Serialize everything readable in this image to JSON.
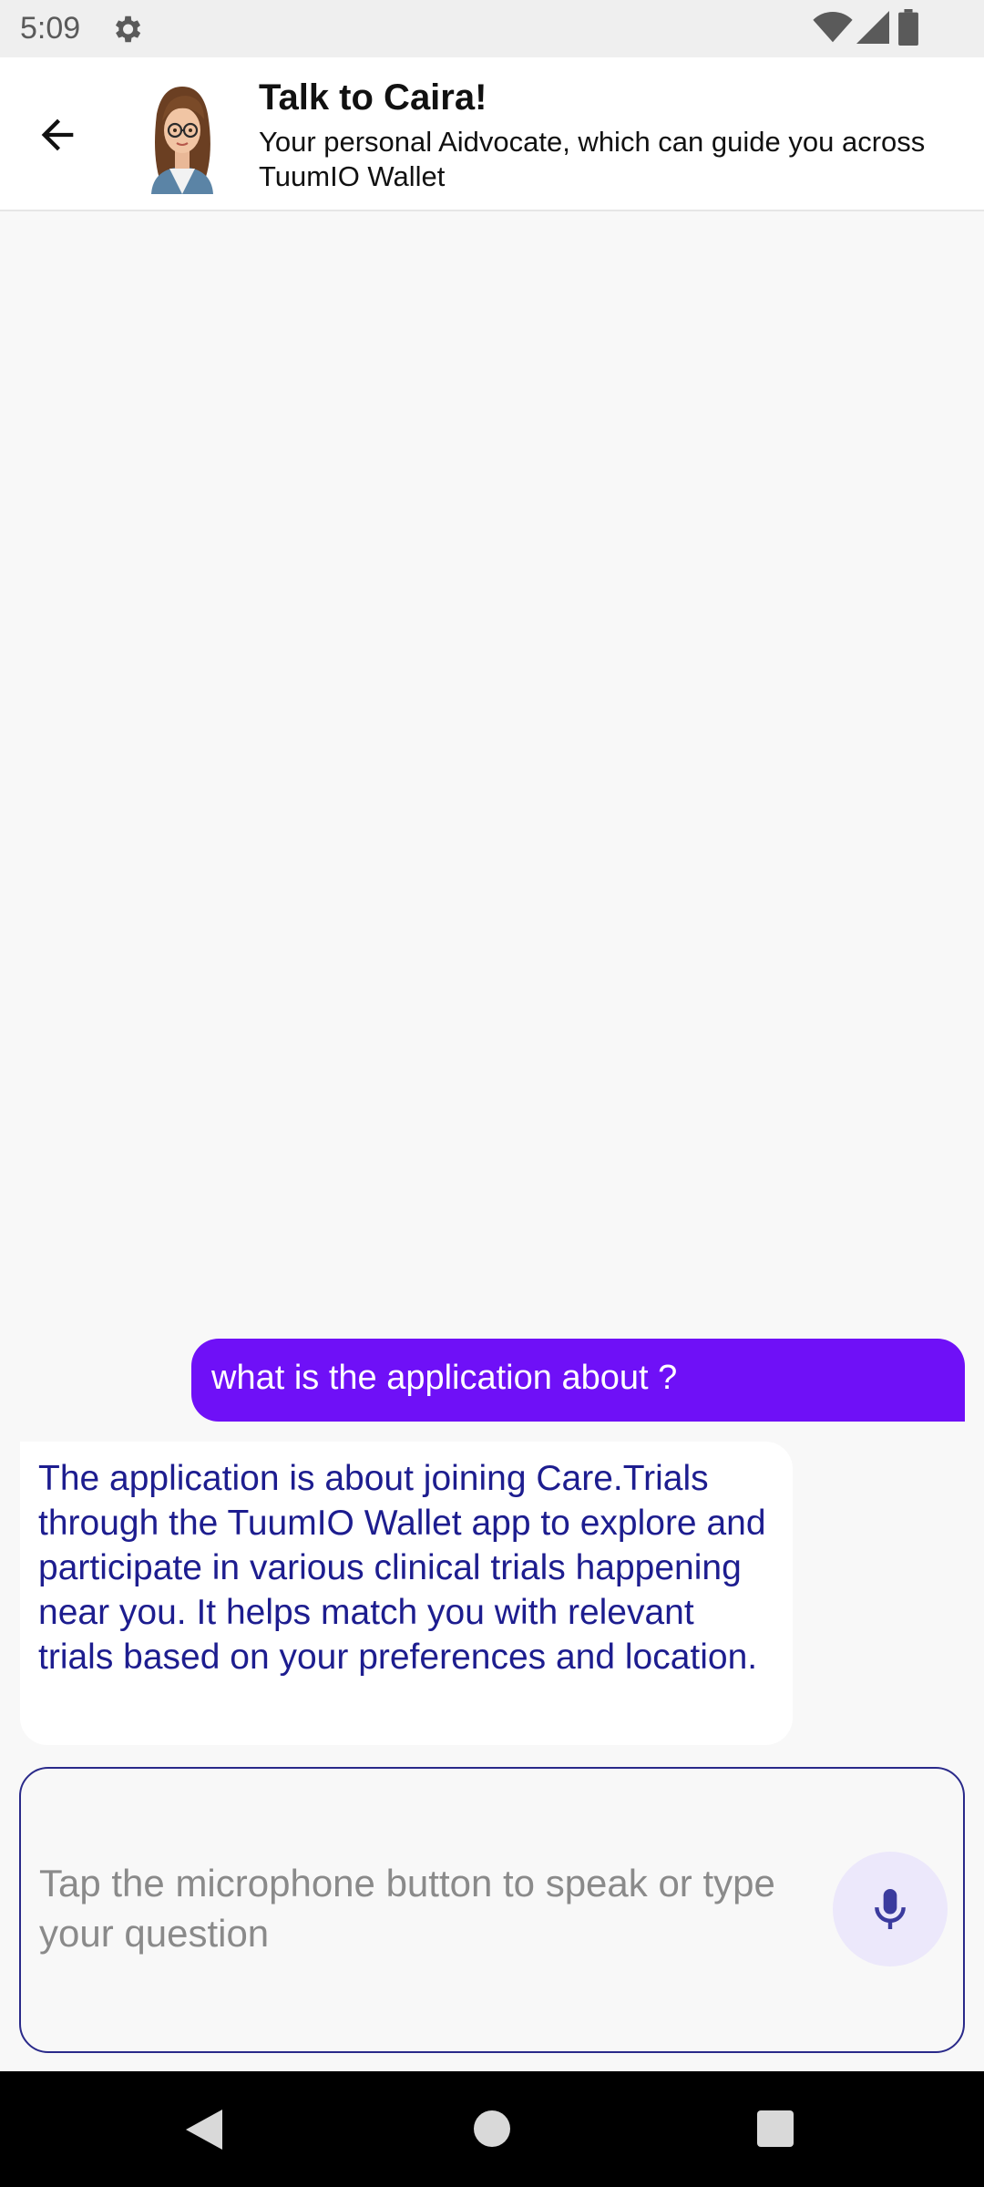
{
  "status_bar": {
    "time": "5:09",
    "icons": [
      "settings-icon",
      "wifi-icon",
      "signal-icon",
      "battery-icon"
    ]
  },
  "header": {
    "back_icon": "arrow-left-icon",
    "title": "Talk to Caira!",
    "subtitle": "Your personal Aidvocate, which can guide you across TuumIO Wallet"
  },
  "messages": [
    {
      "sender": "user",
      "text": "what is the application about ?"
    },
    {
      "sender": "assistant",
      "text": "The application is about joining Care.Trials through the TuumIO Wallet app to explore and participate in various clinical trials happening near you. It helps match you with relevant trials based on your preferences and location."
    }
  ],
  "input": {
    "placeholder": "Tap the microphone button to speak or type your question",
    "mic_icon": "microphone-icon"
  },
  "nav_bar": {
    "icons": [
      "nav-back-icon",
      "nav-home-icon",
      "nav-recents-icon"
    ]
  },
  "colors": {
    "user_bubble": "#6f10f7",
    "assistant_text": "#1d1d8f",
    "input_border": "#2a2a8a",
    "mic_bg": "#ece8fb",
    "mic_icon": "#3b3b9e"
  }
}
